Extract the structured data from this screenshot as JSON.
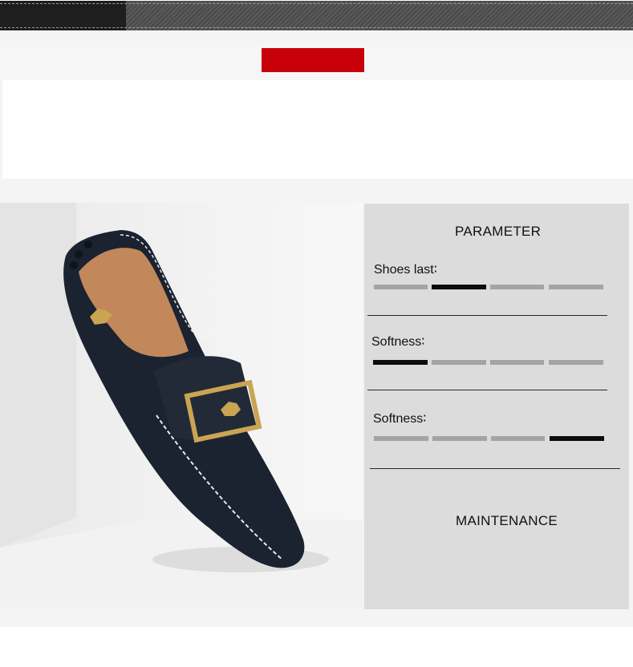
{
  "parameter_panel": {
    "title": "PARAMETER",
    "rows": [
      {
        "label": "Shoes last∶",
        "levels": 4,
        "active": 2
      },
      {
        "label": "Softness∶",
        "levels": 4,
        "active": 1
      },
      {
        "label": "Softness∶",
        "levels": 4,
        "active": 4
      }
    ],
    "maintenance_title": "MAINTENANCE"
  },
  "colors": {
    "accent_red": "#c8000a",
    "panel_gray": "#dcdcdc",
    "shoe_leather": "#1b2230",
    "buckle_gold": "#c9a552"
  },
  "icons": {
    "horse_emblem": "gold-horse-emblem",
    "buckle": "gold-buckle"
  }
}
